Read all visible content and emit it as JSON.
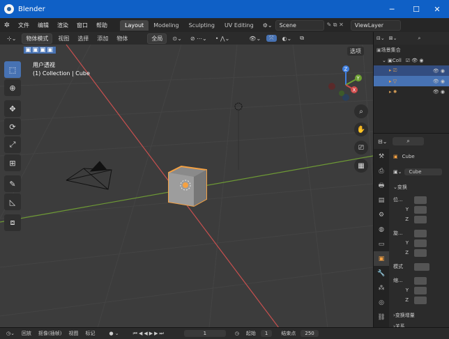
{
  "window": {
    "title": "Blender",
    "minimize": "─",
    "maximize": "☐",
    "close": "✕"
  },
  "menubar": {
    "menus": [
      "文件",
      "编辑",
      "渲染",
      "窗口",
      "帮助"
    ],
    "workspaces": [
      "Layout",
      "Modeling",
      "Sculpting",
      "UV Editing"
    ],
    "active_workspace": "Layout",
    "scene": "Scene",
    "view_layer": "ViewLayer"
  },
  "viewport_header": {
    "mode": "物体模式",
    "menus": [
      "视图",
      "选择",
      "添加",
      "物体"
    ],
    "transform_orientation": "全局",
    "options": "选项"
  },
  "viewport": {
    "view_name": "用户透视",
    "collection_info": "(1) Collection | Cube",
    "gizmo": {
      "z": "Z",
      "y": "Y",
      "x": "X"
    }
  },
  "outliner": {
    "root": "场景集合",
    "collection": "Coll"
  },
  "properties": {
    "object_name": "Cube",
    "object_field": "Cube",
    "section_transform": "变换",
    "location_label": "位...",
    "rotation_label": "旋...",
    "mode_label": "模式",
    "scale_label": "缩...",
    "axes": [
      "Y",
      "Z"
    ],
    "delta_transform": "变换增量",
    "relations": "关系"
  },
  "timeline": {
    "playback": "回放",
    "keying": "抠像(插帧)",
    "view": "视图",
    "marker": "标记",
    "current_frame": "1",
    "start_label": "起始",
    "start_value": "1",
    "end_label": "结束点",
    "end_value": "250"
  },
  "colors": {
    "accent": "#4772b3",
    "title_bar": "#0f60c6",
    "x_axis": "#c8504f",
    "y_axis": "#6e9a35",
    "selection_outline": "#f5a142"
  }
}
